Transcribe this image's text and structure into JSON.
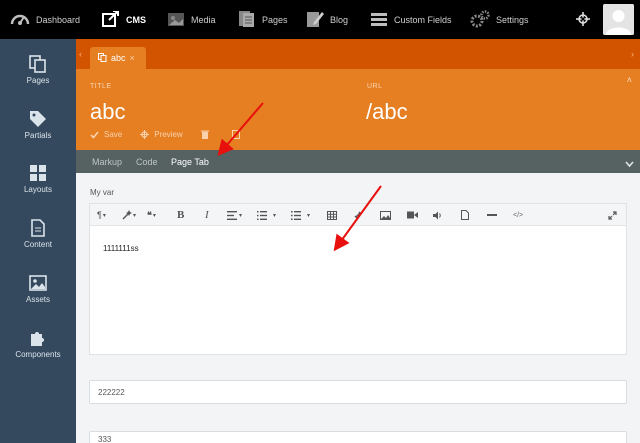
{
  "topnav": {
    "items": [
      {
        "label": "Dashboard",
        "icon": "dashboard-icon"
      },
      {
        "label": "CMS",
        "icon": "cms-icon"
      },
      {
        "label": "Media",
        "icon": "media-icon"
      },
      {
        "label": "Pages",
        "icon": "pages-icon"
      },
      {
        "label": "Blog",
        "icon": "blog-icon"
      },
      {
        "label": "Custom Fields",
        "icon": "menu-icon"
      },
      {
        "label": "Settings",
        "icon": "settings-icon"
      }
    ]
  },
  "sidebar": {
    "items": [
      {
        "label": "Pages",
        "icon": "pages-icon"
      },
      {
        "label": "Partials",
        "icon": "tag-icon"
      },
      {
        "label": "Layouts",
        "icon": "grid-icon"
      },
      {
        "label": "Content",
        "icon": "document-icon"
      },
      {
        "label": "Assets",
        "icon": "image-icon"
      },
      {
        "label": "Components",
        "icon": "puzzle-icon"
      }
    ]
  },
  "tab": {
    "label": "abc"
  },
  "header": {
    "title_label": "TITLE",
    "title_value": "abc",
    "url_label": "URL",
    "url_value": "/abc",
    "actions": {
      "save": "Save",
      "preview": "Preview"
    }
  },
  "subtabs": [
    "Markup",
    "Code",
    "Page Tab"
  ],
  "content": {
    "var_label": "My var",
    "editor_text": "1111111ss",
    "input1": "222222",
    "input2": "333"
  },
  "colors": {
    "topbar": "#000000",
    "sidebar": "#34495e",
    "orange_dark": "#d35400",
    "orange": "#e67e22",
    "subbar": "#566262",
    "annotation_arrow": "#e8100d"
  }
}
